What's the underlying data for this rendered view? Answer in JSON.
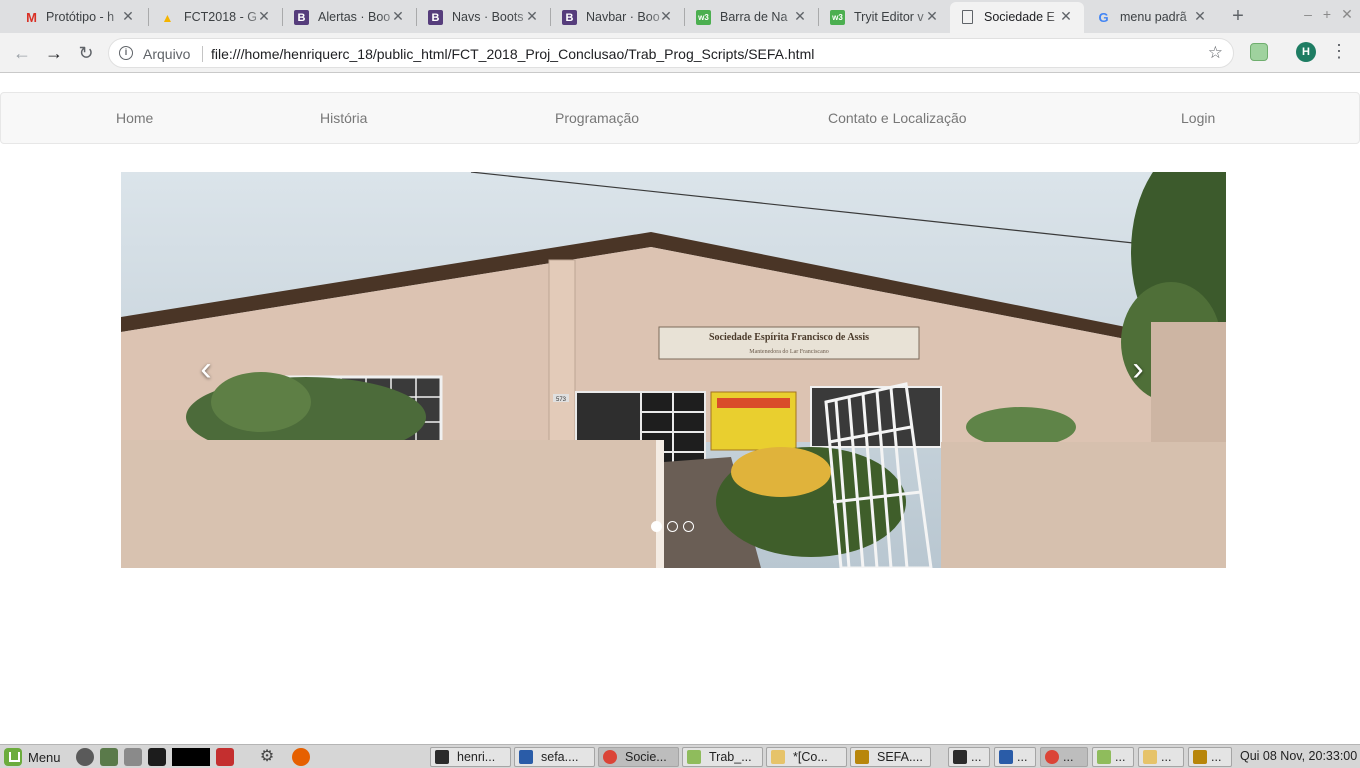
{
  "browser": {
    "tabs": [
      {
        "title": "Protótipo - h",
        "icon": "gmail-icon",
        "color": "#d93025",
        "glyph": "M"
      },
      {
        "title": "FCT2018 - G",
        "icon": "google-drive-icon",
        "color": "#f4b400",
        "glyph": "▲"
      },
      {
        "title": "Alertas · Boo",
        "icon": "bootstrap-icon",
        "color": "#563d7c",
        "glyph": "B"
      },
      {
        "title": "Navs · Boots",
        "icon": "bootstrap-icon",
        "color": "#563d7c",
        "glyph": "B"
      },
      {
        "title": "Navbar · Boo",
        "icon": "bootstrap-icon",
        "color": "#563d7c",
        "glyph": "B"
      },
      {
        "title": "Barra de Na",
        "icon": "w3schools-icon",
        "color": "#4caf50",
        "glyph": "w3"
      },
      {
        "title": "Tryit Editor v",
        "icon": "w3schools-icon",
        "color": "#4caf50",
        "glyph": "w3"
      },
      {
        "title": "Sociedade E",
        "icon": "page-icon",
        "color": "#5f6368",
        "glyph": "▯",
        "active": true
      },
      {
        "title": "menu padrã",
        "icon": "google-icon",
        "color": "#4285f4",
        "glyph": "G"
      }
    ],
    "omnibox": {
      "label": "Arquivo",
      "url": "file:///home/henriquerc_18/public_html/FCT_2018_Proj_Conclusao/Trab_Prog_Scripts/SEFA.html"
    },
    "profile_initial": "H"
  },
  "page": {
    "nav": [
      "Home",
      "História",
      "Programação",
      "Contato e Localização",
      "Login"
    ],
    "carousel": {
      "slide_count": 3,
      "active_slide": 1,
      "sign_text": "Sociedade Espírita Francisco de Assis",
      "sign_subtext": "Mantenedora do Lar Franciscano",
      "house_number": "573"
    }
  },
  "taskbar": {
    "menu_label": "Menu",
    "tasks": [
      {
        "label": "henri...",
        "icon": "terminal-icon",
        "color": "#2b2b2b"
      },
      {
        "label": "sefa....",
        "icon": "code-editor-icon",
        "color": "#2a5ca8"
      },
      {
        "label": "Socie...",
        "icon": "chrome-icon",
        "color": "#db4437",
        "active": true
      },
      {
        "label": "Trab_...",
        "icon": "folder-icon",
        "color": "#8fbc5c"
      },
      {
        "label": "*[Co...",
        "icon": "text-editor-icon",
        "color": "#e6c36a"
      },
      {
        "label": "SEFA....",
        "icon": "gimp-icon",
        "color": "#b8860b"
      },
      {
        "label": "...",
        "icon": "terminal-icon",
        "color": "#2b2b2b"
      },
      {
        "label": "...",
        "icon": "code-editor-icon",
        "color": "#2a5ca8"
      },
      {
        "label": "...",
        "icon": "chrome-icon",
        "color": "#db4437"
      },
      {
        "label": "...",
        "icon": "folder-icon",
        "color": "#8fbc5c"
      },
      {
        "label": "...",
        "icon": "text-editor-icon",
        "color": "#e6c36a"
      },
      {
        "label": "...",
        "icon": "gimp-icon",
        "color": "#b8860b"
      }
    ],
    "clock": "Qui 08 Nov, 20:33:00"
  }
}
